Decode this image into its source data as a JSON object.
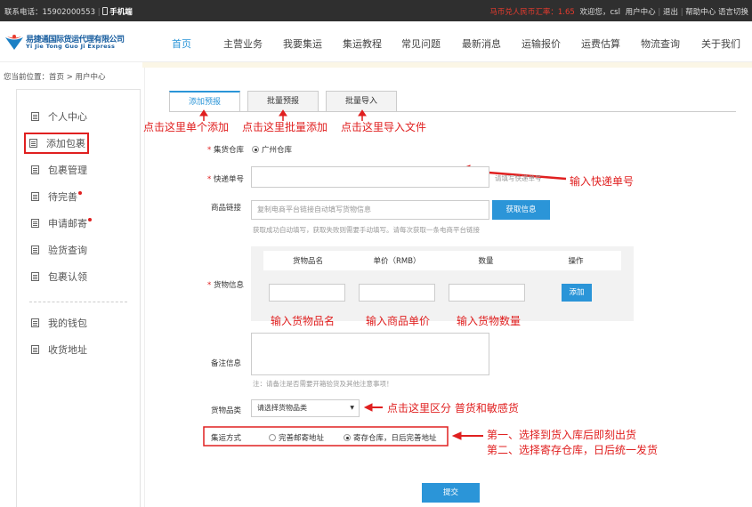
{
  "topbar": {
    "contact": "联系电话：15902000553",
    "mobile": "手机端",
    "rate": "马币兑人民币汇率：1.65",
    "welcome": "欢迎您，csl",
    "user_center": "用户中心",
    "logout": "退出",
    "help": "帮助中心",
    "lang": "语言切换"
  },
  "logo": {
    "cn": "易捷通国际货运代理有限公司",
    "en": "Yi Jie Tong Guo Ji Express"
  },
  "nav": [
    "首页",
    "主营业务",
    "我要集运",
    "集运教程",
    "常见问题",
    "最新消息",
    "运输报价",
    "运费估算",
    "物流查询",
    "关于我们"
  ],
  "breadcrumb": "您当前位置：首页 > 用户中心",
  "sidebar": {
    "items": [
      "个人中心",
      "添加包裹",
      "包裹管理",
      "待完善",
      "申请邮寄",
      "验货查询",
      "包裹认领"
    ],
    "items2": [
      "我的钱包",
      "收货地址"
    ]
  },
  "tabs": [
    "添加预报",
    "批量预报",
    "批量导入"
  ],
  "annotations": {
    "tab1": "点击这里单个添加",
    "tab2": "点击这里批量添加",
    "tab3": "点击这里导入文件",
    "tracking": "输入快递单号",
    "name": "输入货物品名",
    "price": "输入商品单价",
    "qty": "输入货物数量",
    "category": "点击这里区分 普货和敏感货",
    "method1": "第一、选择到货入库后即刻出货",
    "method2": "第二、选择寄存仓库，日后统一发货"
  },
  "form": {
    "warehouse_label": "集货仓库",
    "warehouse_value": "广州仓库",
    "tracking_label": "快递单号",
    "tracking_hint": "请填写快递单号",
    "link_label": "商品链接",
    "link_placeholder": "复制电商平台链接自动填写货物信息",
    "fetch_button": "获取信息",
    "link_hint": "获取成功自动填写，获取失败则需要手动填写。请每次获取一条电商平台链接",
    "goods_label": "货物信息",
    "goods_headers": [
      "货物品名",
      "单价（RMB）",
      "数量",
      "操作"
    ],
    "add_button": "添加",
    "remark_label": "备注信息",
    "remark_hint": "注：请备注是否需要开箱验货及其他注意事项！",
    "category_label": "货物品类",
    "category_value": "请选择货物品类",
    "method_label": "集运方式",
    "method_opt1": "完善邮寄地址",
    "method_opt2": "寄存仓库，日后完善地址",
    "submit": "提交"
  },
  "colors": {
    "accent": "#2b95d8",
    "annotation": "#e02020",
    "topbar": "#2f2f2f"
  }
}
